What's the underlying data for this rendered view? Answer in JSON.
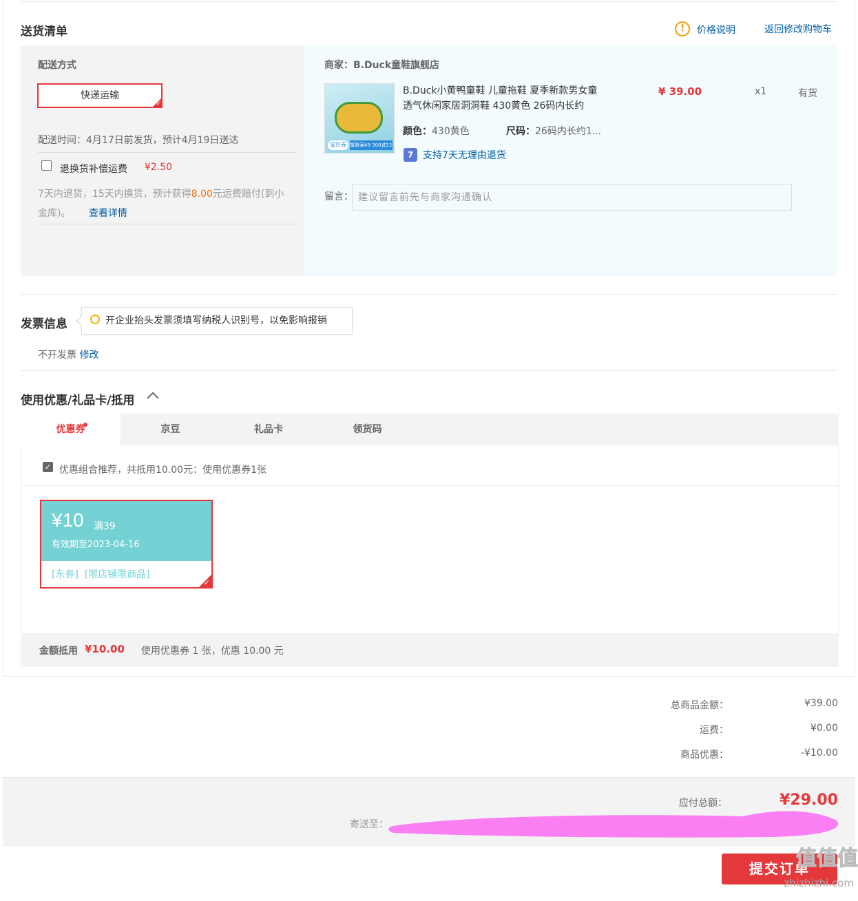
{
  "shipping_list": {
    "title": "送货清单",
    "price_explain": "价格说明",
    "back_to_cart": "返回修改购物车",
    "delivery_method_label": "配送方式",
    "express_option": "快递运输",
    "delivery_time": "配送时间：4月17日前发货，预计4月19日送达",
    "return_insurance_label": "退换货补偿运费",
    "return_insurance_price": "¥2.50",
    "return_insurance_desc_1": "7天内退货，15天内换货，预计获得",
    "return_insurance_amount": "8.00",
    "return_insurance_desc_2": "元运费赔付(到小",
    "return_insurance_desc_3": "金库)。",
    "view_details": "查看详情"
  },
  "merchant": {
    "label": "商家：",
    "name": "B.Duck童鞋旗舰店"
  },
  "product": {
    "title_line1": "B.Duck小黄鸭童鞋 儿童拖鞋 夏季新款男女童",
    "title_line2": "透气休闲家居洞洞鞋 430黄色 26码内长约",
    "price": "¥ 39.00",
    "quantity": "x1",
    "stock": "有货",
    "color_label": "颜色：",
    "color_value": "430黄色",
    "size_label": "尺码：",
    "size_value": "26码内长约1...",
    "return_badge": "7",
    "return_policy": "支持7天无理由退货",
    "img_badge": "宝贝券",
    "img_banner": "童鞋满49 300减120"
  },
  "note": {
    "label": "留言：",
    "placeholder": "建议留言前先与商家沟通确认"
  },
  "invoice": {
    "title": "发票信息",
    "tip": "开企业抬头发票须填写纳税人识别号，以免影响报销",
    "status": "不开发票",
    "edit": "修改"
  },
  "discounts": {
    "title": "使用优惠/礼品卡/抵用",
    "tabs": [
      "优惠券",
      "京豆",
      "礼品卡",
      "领货码"
    ],
    "recommend_text": "优惠组合推荐，共抵用10.00元：使用优惠券1张",
    "coupon": {
      "amount": "¥10",
      "condition": "满39",
      "validity": "有效期至2023-04-16",
      "tags": "[东券]  [限店铺限商品]"
    },
    "summary_label": "金额抵用",
    "summary_amount": "¥10.00",
    "summary_desc": "使用优惠券 1 张，优惠 10.00 元"
  },
  "totals": {
    "goods_label": "总商品金额：",
    "goods_value": "¥39.00",
    "shipping_label": "运费：",
    "shipping_value": "¥0.00",
    "discount_label": "商品优惠：",
    "discount_value": "-¥10.00",
    "payable_label": "应付总额：",
    "payable_value": "¥29.00",
    "ship_to_label": "寄送至："
  },
  "submit": {
    "label": "提交订单"
  },
  "watermark": {
    "line1": "值值值",
    "line2": "zhizhizhi.com"
  },
  "colors": {
    "accent_red": "#e4393c",
    "link_blue": "#005ea7",
    "coupon_teal": "#74d2d4",
    "redaction_pink": "#f97ff2"
  }
}
